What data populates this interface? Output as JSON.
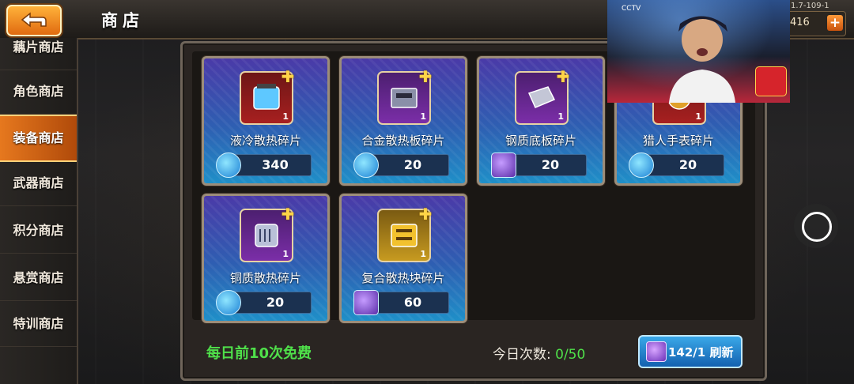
{
  "header": {
    "title": "商店",
    "version": "1.7-109-1",
    "currency_value": "416"
  },
  "sidebar": {
    "items": [
      {
        "label": "藕片商店",
        "active": false
      },
      {
        "label": "角色商店",
        "active": false
      },
      {
        "label": "装备商店",
        "active": true
      },
      {
        "label": "武器商店",
        "active": false
      },
      {
        "label": "积分商店",
        "active": false
      },
      {
        "label": "悬赏商店",
        "active": false
      },
      {
        "label": "特训商店",
        "active": false
      }
    ]
  },
  "shop": {
    "items": [
      {
        "name": "液冷散热碎片",
        "qty": "1",
        "price": "340",
        "currency": "blue-crystal",
        "icon": "liquid-cooler-icon"
      },
      {
        "name": "合金散热板碎片",
        "qty": "1",
        "price": "20",
        "currency": "blue-crystal",
        "icon": "alloy-heat-plate-icon"
      },
      {
        "name": "钢质底板碎片",
        "qty": "1",
        "price": "20",
        "currency": "purple-token",
        "icon": "steel-base-plate-icon"
      },
      {
        "name": "猎人手表碎片",
        "qty": "1",
        "price": "20",
        "currency": "blue-crystal",
        "icon": "hunter-watch-icon"
      },
      {
        "name": "铜质散热碎片",
        "qty": "1",
        "price": "20",
        "currency": "blue-crystal",
        "icon": "copper-heatsink-icon"
      },
      {
        "name": "复合散热块碎片",
        "qty": "1",
        "price": "60",
        "currency": "purple-token",
        "icon": "composite-heat-block-icon"
      }
    ],
    "free_text": "每日前10次免费",
    "count_label": "今日次数:",
    "count_value": "0/50",
    "refresh_label": "142/1 刷新"
  },
  "overlay": {
    "logo_text": "CCTV"
  },
  "colors": {
    "accent_orange": "#e6781e",
    "free_green": "#4fe04a",
    "refresh_blue": "#1f86d4"
  }
}
